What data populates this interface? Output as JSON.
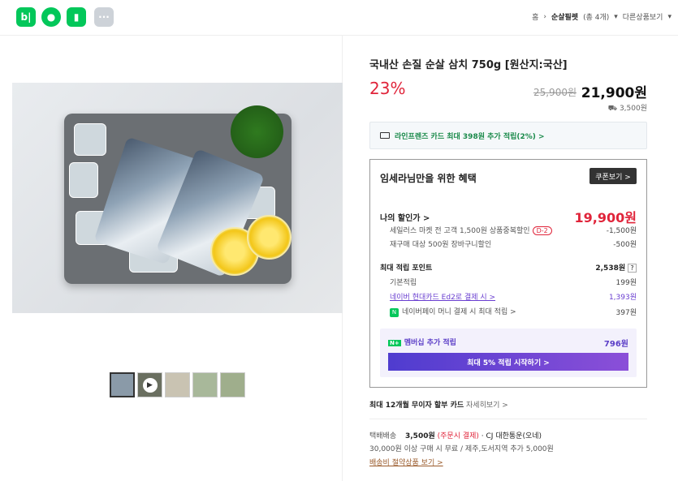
{
  "topbar": {
    "icons": [
      "blog-icon",
      "talk-icon",
      "bookmark-icon",
      "more-icon"
    ],
    "breadcrumb": {
      "home": "홈",
      "category": "순살필렛",
      "count": "(총 4개)",
      "other": "다른상품보기"
    }
  },
  "product": {
    "title": "국내산 손질 순살 삼치 750g [원산지:국산]",
    "discount": "23%",
    "original_price": "25,900원",
    "price": "21,900원",
    "shipping_fee": "3,500원"
  },
  "lifeprince": {
    "text": "라인프렌즈 카드 최대 398원 추가 적립(2%) >"
  },
  "benefit": {
    "title": "임세라님만을 위한 혜택",
    "coupon_btn": "쿠폰보기 >",
    "my_price_label": "나의 할인가 >",
    "my_price": "19,900원",
    "discounts": [
      {
        "label": "세일러스 마켓 전 고객 1,500원 상품중복할인",
        "badge": "D-2",
        "value": "-1,500원"
      },
      {
        "label": "재구매 대상 500원 장바구니할인",
        "badge": "",
        "value": "-500원"
      }
    ],
    "points_label": "최대 적립 포인트",
    "points": "2,538원",
    "point_rows": [
      {
        "label": "기본적립",
        "value": "199원"
      },
      {
        "label": "네이버 현대카드 Ed2로 결제 시 >",
        "value": "1,393원"
      },
      {
        "label": "네이버페이 머니 결제 시 최대 적립 >",
        "value": "397원"
      }
    ],
    "membership_label": "멤버십 추가 적립",
    "membership_value": "796원",
    "membership_btn": "최대 5% 적립 시작하기 >"
  },
  "card_install": {
    "text": "최대 12개월 무이자 할부 카드",
    "link": "자세히보기 >"
  },
  "delivery": {
    "key": "택배배송",
    "fee": "3,500원",
    "fee_note": "(주문시 결제)",
    "carrier": "· CJ 대한통운(오네)",
    "free_note": "30,000원 이상 구매 시 무료 / 제주,도서지역 추가 5,000원",
    "saving_link": "배송비 절약상품 보기 >"
  },
  "colors": {
    "accent_red": "#e0243a",
    "purple": "#5b3ec7",
    "naver_green": "#03c75a"
  }
}
